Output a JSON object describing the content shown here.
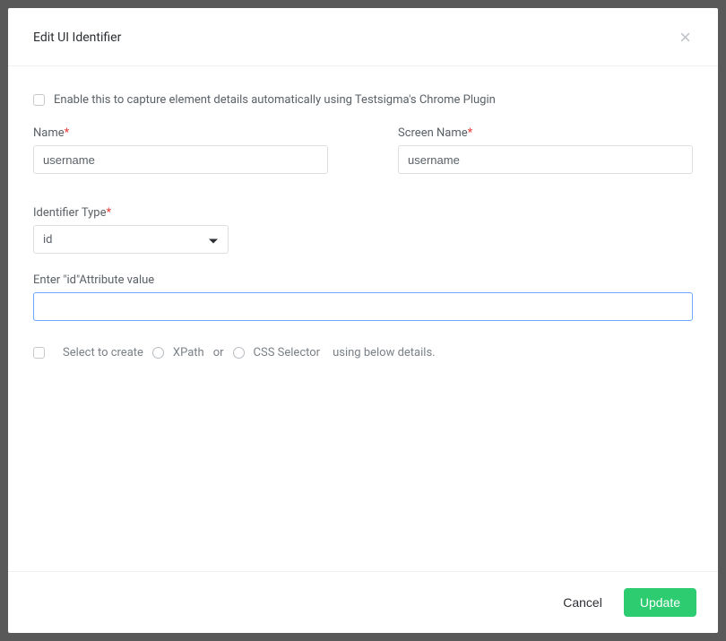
{
  "modal": {
    "title": "Edit UI Identifier"
  },
  "form": {
    "enable_capture_label": "Enable this to capture element details automatically using Testsigma's Chrome Plugin",
    "name": {
      "label": "Name",
      "value": "username"
    },
    "screen_name": {
      "label": "Screen Name",
      "value": "username"
    },
    "identifier_type": {
      "label": "Identifier Type",
      "value": "id"
    },
    "attr_value": {
      "label": "Enter \"id\"Attribute value",
      "value": ""
    },
    "selector_row": {
      "select_to_create": "Select to create",
      "xpath": "XPath",
      "or": "or",
      "css_selector": "CSS Selector",
      "suffix": "using below details."
    }
  },
  "footer": {
    "cancel": "Cancel",
    "update": "Update"
  }
}
